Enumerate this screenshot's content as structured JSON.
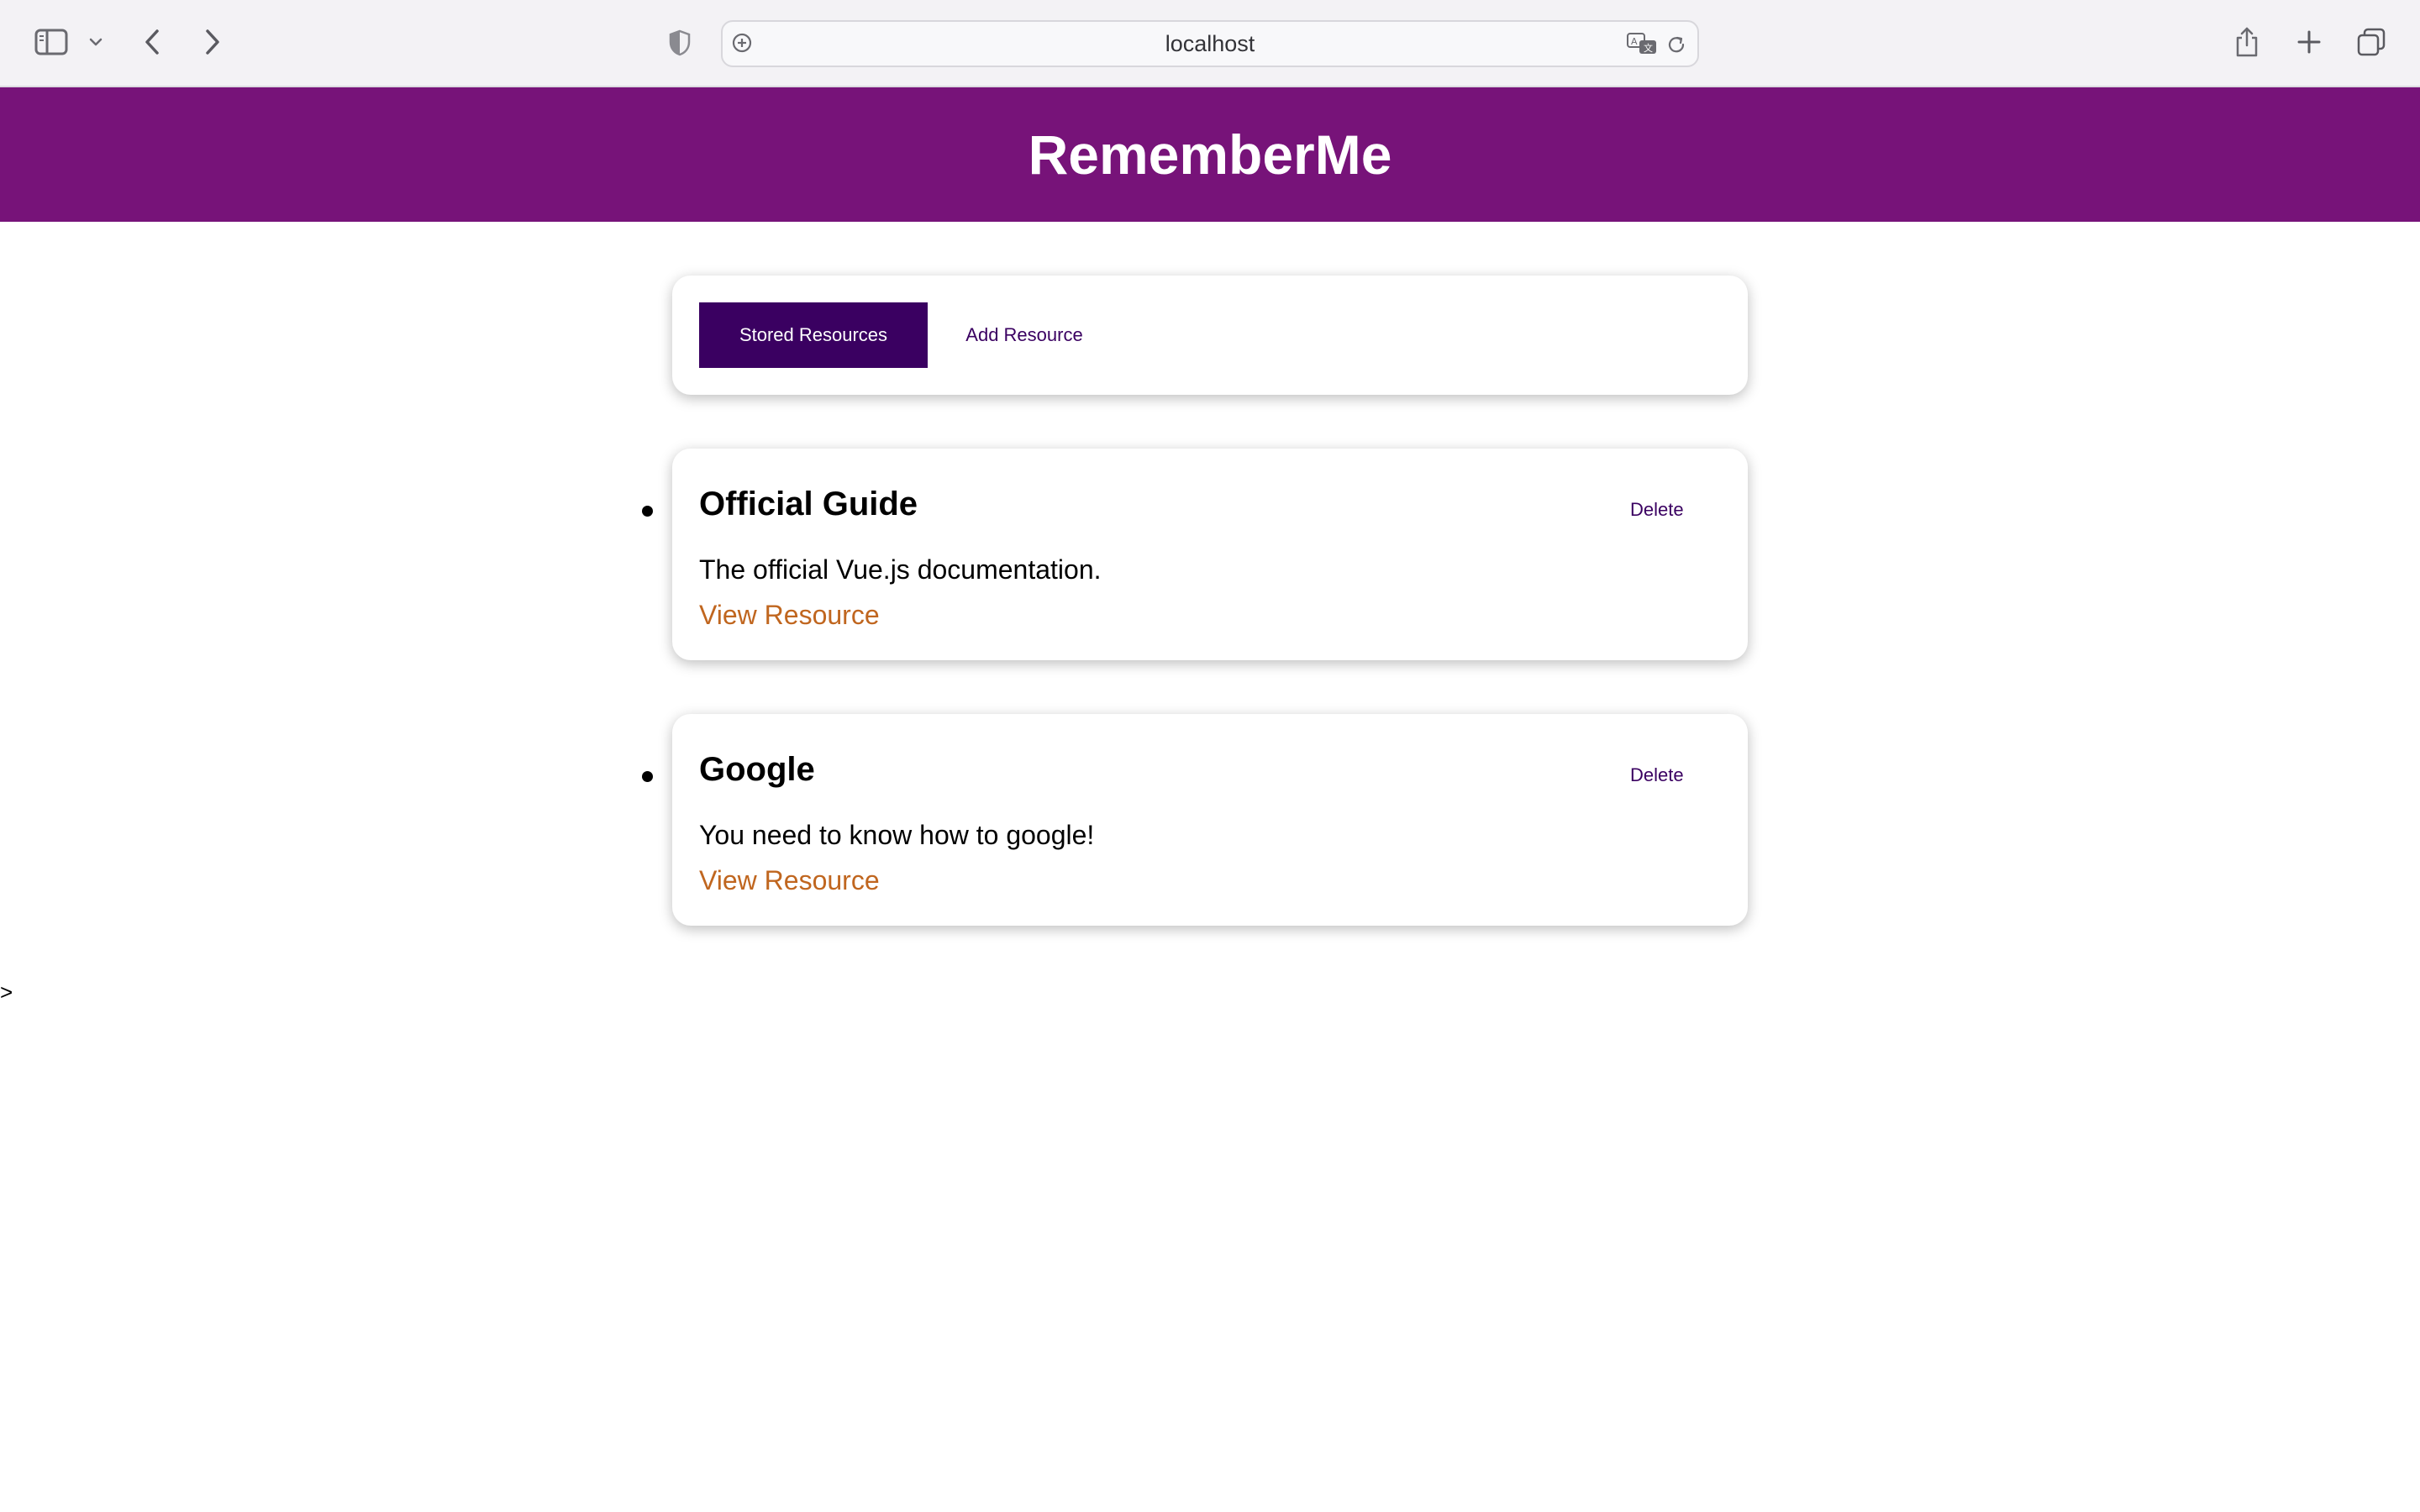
{
  "browser": {
    "url": "localhost",
    "icons": {
      "sidebar": "sidebar-icon",
      "sidebar_menu": "chevron-down-icon",
      "back": "chevron-left-icon",
      "forward": "chevron-right-icon",
      "privacy": "shield-icon",
      "site_info": "plus-circle-icon",
      "translate": "translate-icon",
      "reload": "reload-icon",
      "share": "share-icon",
      "new_tab": "plus-icon",
      "tab_overview": "tabs-icon"
    }
  },
  "header": {
    "title": "RememberMe",
    "background": "#771379"
  },
  "tabs": {
    "stored_label": "Stored Resources",
    "add_label": "Add Resource",
    "active_color": "#3a0061"
  },
  "resources": [
    {
      "title": "Official Guide",
      "delete_label": "Delete",
      "description": "The official Vue.js documentation.",
      "link_label": "View Resource"
    },
    {
      "title": "Google",
      "delete_label": "Delete",
      "description": "You need to know how to google!",
      "link_label": "View Resource"
    }
  ],
  "colors": {
    "link": "#c0661f",
    "accent": "#3a0061"
  },
  "stray_text": ">"
}
